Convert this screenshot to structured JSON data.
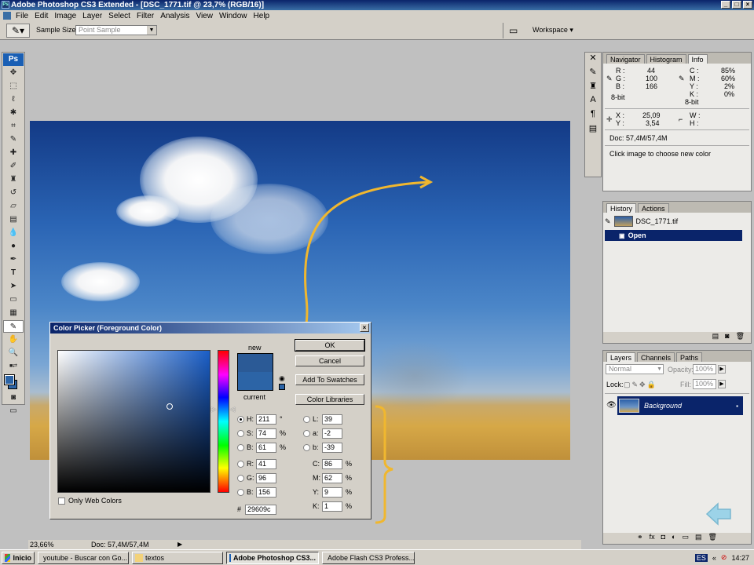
{
  "app": {
    "title": "Adobe Photoshop CS3 Extended - [DSC_1771.tif @ 23,7% (RGB/16)]",
    "menu": [
      "File",
      "Edit",
      "Image",
      "Layer",
      "Select",
      "Filter",
      "Analysis",
      "View",
      "Window",
      "Help"
    ]
  },
  "options_bar": {
    "sample_size_label": "Sample Size:",
    "sample_size_value": "Point Sample",
    "workspace_label": "Workspace"
  },
  "status": {
    "zoom": "23,66%",
    "doc": "Doc: 57,4M/57,4M"
  },
  "info_panel": {
    "tabs": [
      "Navigator",
      "Histogram",
      "Info"
    ],
    "rgb": {
      "r_label": "R :",
      "r": "44",
      "g_label": "G :",
      "g": "100",
      "b_label": "B :",
      "b": "166"
    },
    "cmyk": {
      "c_label": "C :",
      "c": "85%",
      "m_label": "M :",
      "m": "60%",
      "y_label": "Y :",
      "y": "2%",
      "k_label": "K :",
      "k": "0%"
    },
    "bit_left": "8-bit",
    "bit_right": "8-bit",
    "coords": {
      "x_label": "X :",
      "x": "25,09",
      "y_label": "Y :",
      "y": "3,54",
      "w_label": "W :",
      "h_label": "H :"
    },
    "doc": "Doc: 57,4M/57,4M",
    "hint": "Click image to choose new color"
  },
  "history_panel": {
    "tabs": [
      "History",
      "Actions"
    ],
    "snapshot": "DSC_1771.tif",
    "items": [
      "Open"
    ]
  },
  "layers_panel": {
    "tabs": [
      "Layers",
      "Channels",
      "Paths"
    ],
    "blend_mode": "Normal",
    "opacity_label": "Opacity:",
    "opacity": "100%",
    "lock_label": "Lock:",
    "fill_label": "Fill:",
    "fill": "100%",
    "layer_name": "Background"
  },
  "color_picker": {
    "title": "Color Picker (Foreground Color)",
    "new_label": "new",
    "current_label": "current",
    "buttons": {
      "ok": "OK",
      "cancel": "Cancel",
      "add_swatches": "Add To Swatches",
      "libraries": "Color Libraries"
    },
    "only_web": "Only Web Colors",
    "hsb": {
      "h": "211",
      "h_unit": "°",
      "s": "74",
      "s_unit": "%",
      "b": "61",
      "b_unit": "%"
    },
    "rgb": {
      "r": "41",
      "g": "96",
      "b": "156"
    },
    "lab": {
      "l": "39",
      "a": "-2",
      "b": "-39"
    },
    "cmyk": {
      "c": "86",
      "m": "62",
      "y": "9",
      "k": "1",
      "unit": "%"
    },
    "hex_label": "#",
    "hex": "29609c",
    "labels": {
      "H": "H:",
      "S": "S:",
      "B": "B:",
      "R": "R:",
      "G": "G:",
      "Bl": "B:",
      "L": "L:",
      "a": "a:",
      "b": "b:",
      "C": "C:",
      "M": "M:",
      "Y": "Y:",
      "K": "K:"
    },
    "new_color": "#2b5a96",
    "current_color": "#2c64a6"
  },
  "taskbar": {
    "start": "Inicio",
    "items": [
      "youtube - Buscar con Go...",
      "textos",
      "Adobe Photoshop CS3...",
      "Adobe Flash CS3 Profess..."
    ],
    "lang": "ES",
    "clock": "14:27"
  }
}
